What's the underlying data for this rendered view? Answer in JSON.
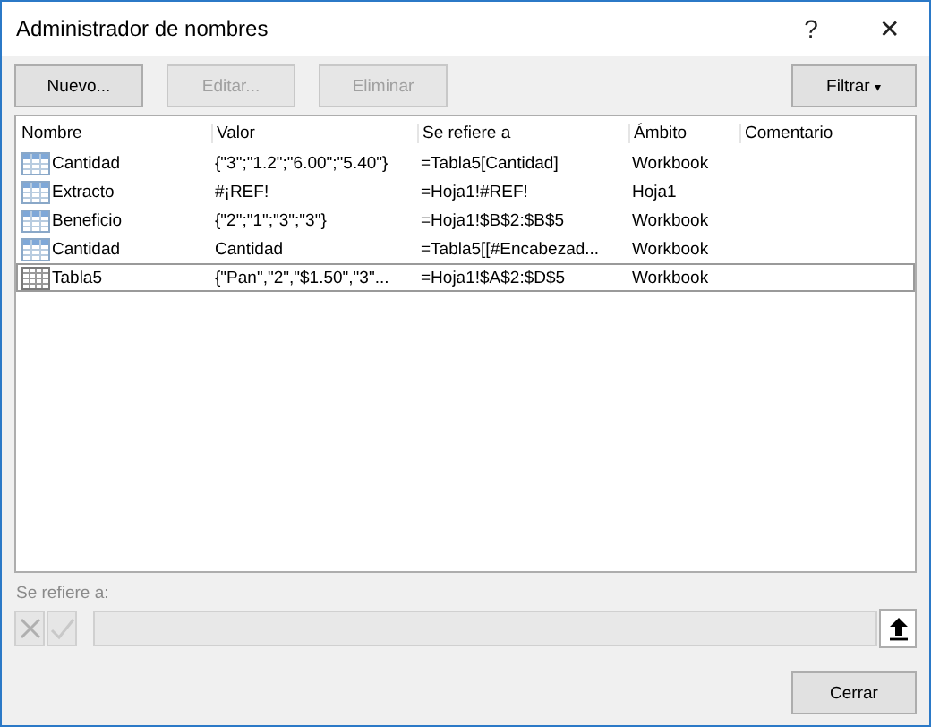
{
  "window": {
    "title": "Administrador de nombres",
    "help": "?",
    "close": "✕"
  },
  "toolbar": [
    {
      "label": "Nuevo...",
      "disabled": false
    },
    {
      "label": "Editar...",
      "disabled": true
    },
    {
      "label": "Eliminar",
      "disabled": true
    }
  ],
  "filter_button": {
    "label": "Filtrar",
    "caret": "▾"
  },
  "table": {
    "columns": [
      "Nombre",
      "Valor",
      "Se refiere a",
      "Ámbito",
      "Comentario"
    ],
    "rows": [
      {
        "kind": "range",
        "selected": false,
        "cells": [
          "Cantidad",
          "{\"3\";\"1.2\";\"6.00\";\"5.40\"}",
          "=Tabla5[Cantidad]",
          "Workbook"
        ]
      },
      {
        "kind": "range",
        "selected": false,
        "cells": [
          "Extracto",
          "#¡REF!",
          "=Hoja1!#REF!",
          "Hoja1"
        ]
      },
      {
        "kind": "range",
        "selected": false,
        "cells": [
          "Beneficio",
          "{\"2\";\"1\";\"3\";\"3\"}",
          "=Hoja1!$B$2:$B$5",
          "Workbook"
        ]
      },
      {
        "kind": "range",
        "selected": false,
        "cells": [
          "Cantidad",
          "Cantidad",
          "=Tabla5[[#Encabezad...",
          "Workbook"
        ]
      },
      {
        "kind": "table",
        "selected": true,
        "cells": [
          "Tabla5",
          "{\"Pan\",\"2\",\"$1.50\",\"3\"...",
          "=Hoja1!$A$2:$D$5",
          "Workbook"
        ]
      }
    ]
  },
  "refers_to": {
    "label": "Se refiere a:",
    "disabled": true
  },
  "footer": {
    "button": "Cerrar"
  }
}
